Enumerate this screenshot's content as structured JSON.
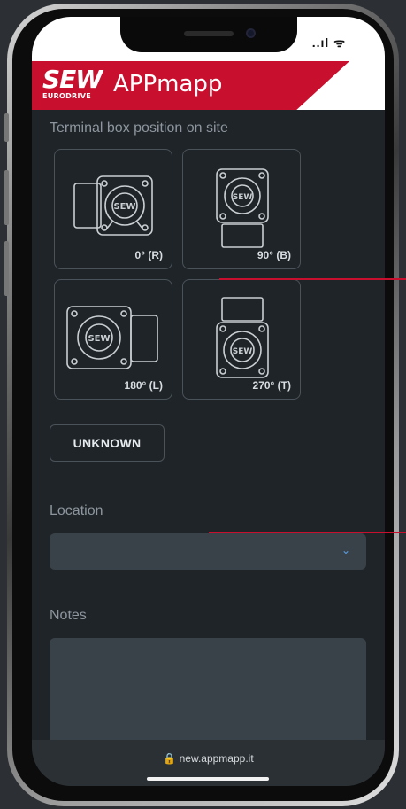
{
  "app": {
    "logo_main": "SEW",
    "logo_sub": "EURODRIVE",
    "title": "APPmapp"
  },
  "status": {
    "icons": "..ıl ᯤ"
  },
  "terminal": {
    "label": "Terminal box position on site",
    "options": [
      {
        "label": "0° (R)",
        "icon": "motor-terminal-right-icon"
      },
      {
        "label": "90° (B)",
        "icon": "motor-terminal-bottom-icon"
      },
      {
        "label": "180° (L)",
        "icon": "motor-terminal-left-icon"
      },
      {
        "label": "270° (T)",
        "icon": "motor-terminal-top-icon"
      }
    ],
    "unknown_label": "UNKNOWN"
  },
  "location": {
    "label": "Location",
    "value": "",
    "chevron": "⌄"
  },
  "notes": {
    "label": "Notes",
    "value": ""
  },
  "browser": {
    "url": "🔒 new.appmapp.it"
  },
  "colors": {
    "brand_red": "#c8102e",
    "background": "#1f2428",
    "field": "#3a4249"
  }
}
